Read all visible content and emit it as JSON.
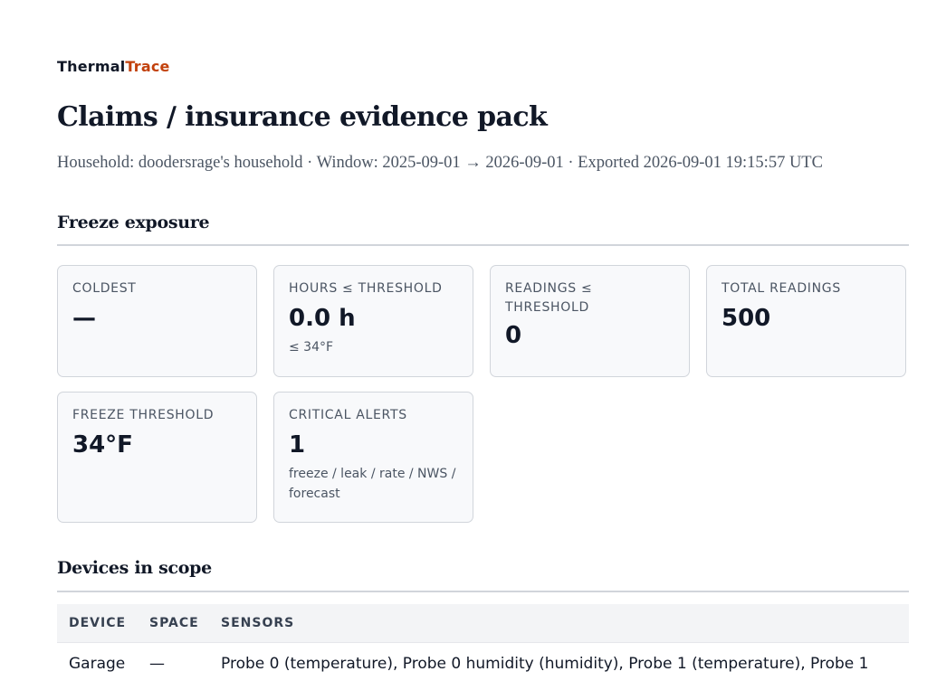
{
  "brand": {
    "part1": "Thermal",
    "part2": "Trace"
  },
  "page_title": "Claims / insurance evidence pack",
  "meta_line": "Household: doodersrage's household · Window: 2025-09-01 → 2026-09-01 · Exported 2026-09-01 19:15:57 UTC",
  "freeze_section": {
    "title": "Freeze exposure",
    "cards": [
      {
        "label": "COLDEST",
        "value": "—",
        "sub": ""
      },
      {
        "label": "HOURS ≤ THRESHOLD",
        "value": "0.0 h",
        "sub": "≤ 34°F"
      },
      {
        "label": "READINGS ≤ THRESHOLD",
        "value": "0",
        "sub": ""
      },
      {
        "label": "TOTAL READINGS",
        "value": "500",
        "sub": ""
      },
      {
        "label": "FREEZE THRESHOLD",
        "value": "34°F",
        "sub": ""
      },
      {
        "label": "CRITICAL ALERTS",
        "value": "1",
        "sub": "freeze / leak / rate / NWS / forecast"
      }
    ]
  },
  "devices_section": {
    "title": "Devices in scope",
    "columns": [
      "DEVICE",
      "SPACE",
      "SENSORS"
    ],
    "rows": [
      {
        "device": "Garage",
        "space": "—",
        "sensors": "Probe 0 (temperature), Probe 0 humidity (humidity), Probe 1 (temperature), Probe 1"
      }
    ]
  },
  "colors": {
    "brand_accent": "#c2410c",
    "text": "#111827",
    "muted": "#4b5563",
    "card_border": "#d1d5db",
    "card_bg": "#f8f9fb",
    "table_header_bg": "#f3f4f6"
  }
}
